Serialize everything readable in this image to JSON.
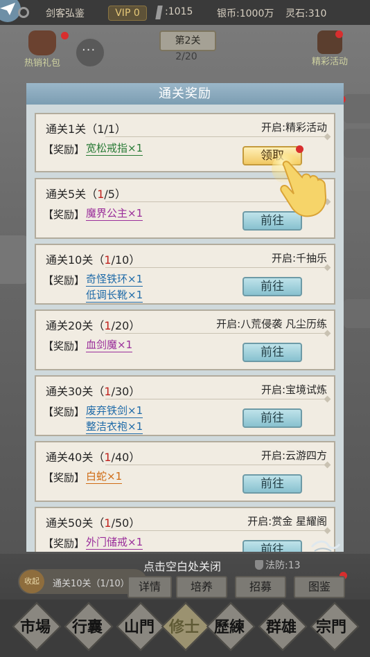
{
  "topbar": {
    "title": "剑客弘鉴",
    "vip": "VIP 0",
    "energy": ":1015",
    "silver": "银币:1000万",
    "spirit_stone": "灵石:310"
  },
  "stage": {
    "name": "第2关",
    "progress": "2/20"
  },
  "gift_left_label": "热销礼包",
  "gift_right_label": "精彩活动",
  "dialog": {
    "title": "通关奖励",
    "reward_label": "【奖励】",
    "cards": [
      {
        "title_pre": "通关1关（",
        "current": "1",
        "title_post": "/1）",
        "current_plain": true,
        "unlock": "开启:精彩活动",
        "rewards": [
          "宽松戒指×1"
        ],
        "reward_colors": [
          "green"
        ],
        "button": "领取",
        "button_type": "claim"
      },
      {
        "title_pre": "通关5关（",
        "current": "1",
        "title_post": "/5）",
        "unlock": "",
        "rewards": [
          "魔界公主×1"
        ],
        "reward_colors": [
          "purple"
        ],
        "button": "前往",
        "button_type": "go"
      },
      {
        "title_pre": "通关10关（",
        "current": "1",
        "title_post": "/10）",
        "unlock": "开启:千抽乐",
        "rewards": [
          "奇怪铁环×1",
          "低调长靴×1"
        ],
        "reward_colors": [
          "blue",
          "blue"
        ],
        "button": "前往",
        "button_type": "go"
      },
      {
        "title_pre": "通关20关（",
        "current": "1",
        "title_post": "/20）",
        "unlock": "开启:八荒侵袭 凡尘历练",
        "rewards": [
          "血剑魔×1"
        ],
        "reward_colors": [
          "purple"
        ],
        "button": "前往",
        "button_type": "go"
      },
      {
        "title_pre": "通关30关（",
        "current": "1",
        "title_post": "/30）",
        "unlock": "开启:宝境试炼",
        "rewards": [
          "废弃铁剑×1",
          "整洁衣袍×1"
        ],
        "reward_colors": [
          "blue",
          "blue"
        ],
        "button": "前往",
        "button_type": "go"
      },
      {
        "title_pre": "通关40关（",
        "current": "1",
        "title_post": "/40）",
        "unlock": "开启:云游四方",
        "rewards": [
          "白蛇×1"
        ],
        "reward_colors": [
          "orange"
        ],
        "button": "前往",
        "button_type": "go"
      },
      {
        "title_pre": "通关50关（",
        "current": "1",
        "title_post": "/50）",
        "unlock": "开启:赏金 星耀阁",
        "rewards": [
          "外门储戒×1"
        ],
        "reward_colors": [
          "purple"
        ],
        "button": "前往",
        "button_type": "go"
      }
    ]
  },
  "close_hint": "点击空白处关闭",
  "magic_defense": "法防:13",
  "quest": {
    "seal": "收起",
    "text": "通关10关（1/10）"
  },
  "bottom_tabs": [
    "详情",
    "培养",
    "招募",
    "图鉴"
  ],
  "nav": [
    "市場",
    "行囊",
    "山門",
    "修士",
    "歷練",
    "群雄",
    "宗門"
  ]
}
